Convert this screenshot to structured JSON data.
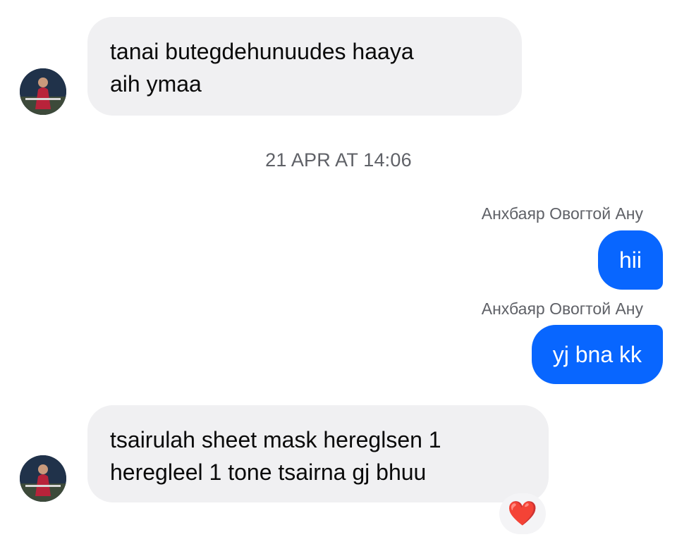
{
  "messages": {
    "incoming_1": {
      "lines": [
        "tanai butegdehunuudes haaya",
        "aih ymaa"
      ]
    },
    "timestamp": "21 APR AT 14:06",
    "outgoing_1": {
      "sender": "Анхбаяр Овогтой Ану",
      "text": "hii"
    },
    "outgoing_2": {
      "sender": "Анхбаяр Овогтой Ану",
      "text": "yj bna kk"
    },
    "incoming_2": {
      "lines": [
        "tsairulah sheet mask hereglsen 1",
        "heregleel 1 tone tsairna gj bhuu"
      ],
      "reaction": "❤️"
    }
  },
  "colors": {
    "outgoing_bubble": "#0866ff",
    "incoming_bubble": "#f0f0f2",
    "meta_text": "#5f6167",
    "reaction_heart": "#e0243a"
  },
  "icons": {
    "avatar": "contact-avatar-photo",
    "reaction": "heart-reaction-icon"
  }
}
